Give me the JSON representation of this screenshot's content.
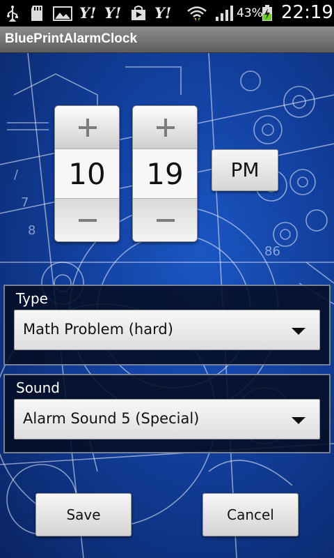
{
  "status_bar": {
    "icons": [
      "usb-icon",
      "sd-card-icon",
      "gallery-icon",
      "yahoo-icon",
      "yahoo-icon",
      "shopping-bag-icon",
      "yahoo-icon",
      "wifi-icon",
      "signal-icon",
      "battery-charging-icon"
    ],
    "yahoo_label": "Y!",
    "battery_percent": "43%",
    "time": "22:19"
  },
  "app": {
    "title": "BluePrintAlarmClock"
  },
  "time_picker": {
    "hour": "10",
    "minute": "19",
    "ampm": "PM",
    "plus_icon": "plus-icon",
    "minus_icon": "minus-icon"
  },
  "type_section": {
    "label": "Type",
    "selected": "Math Problem (hard)"
  },
  "sound_section": {
    "label": "Sound",
    "selected": "Alarm Sound 5 (Special)"
  },
  "actions": {
    "save_label": "Save",
    "cancel_label": "Cancel"
  },
  "colors": {
    "blueprint_bg": "#123f9c",
    "panel_bg": "#050c23",
    "status_bar": "#000000",
    "title_bar": "#6e6e6e"
  }
}
